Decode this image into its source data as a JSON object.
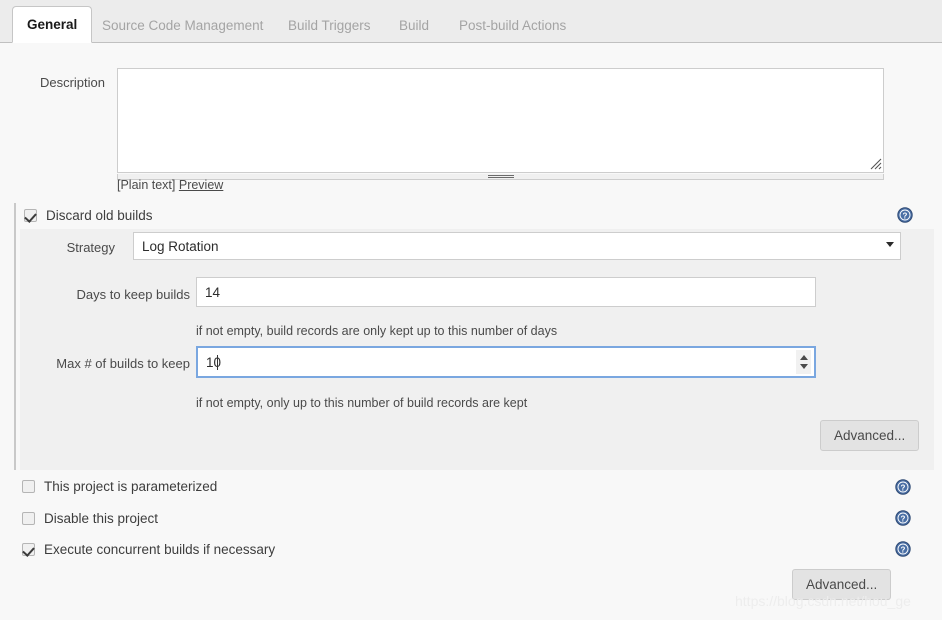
{
  "tabs": [
    {
      "label": "General",
      "active": true
    },
    {
      "label": "Source Code Management",
      "active": false
    },
    {
      "label": "Build Triggers",
      "active": false
    },
    {
      "label": "Build",
      "active": false
    },
    {
      "label": "Post-build Actions",
      "active": false
    }
  ],
  "description": {
    "label": "Description",
    "value": "",
    "placeholder": "",
    "markup_note": "[Plain text]",
    "preview_link": "Preview",
    "resize_handle_icon": "resize-grip-icon",
    "drag_bar_icon": "drag-grip-icon"
  },
  "discard_old_builds": {
    "label": "Discard old builds",
    "checked": true,
    "help_icon": "help-question-icon",
    "strategy": {
      "label": "Strategy",
      "value": "Log Rotation",
      "options": [
        "Log Rotation"
      ],
      "arrow_icon": "chevron-down-icon"
    },
    "days_to_keep": {
      "label": "Days to keep builds",
      "value": "14",
      "hint": "if not empty, build records are only kept up to this number of days"
    },
    "max_builds_to_keep": {
      "label": "Max # of builds to keep",
      "value": "10",
      "hint": "if not empty, only up to this number of build records are kept",
      "focused": true,
      "spinner_up_icon": "spinner-up-icon",
      "spinner_down_icon": "spinner-down-icon"
    },
    "advanced_button": "Advanced..."
  },
  "options": [
    {
      "label": "This project is parameterized",
      "checked": false,
      "help_icon": "help-question-icon"
    },
    {
      "label": "Disable this project",
      "checked": false,
      "help_icon": "help-question-icon"
    },
    {
      "label": "Execute concurrent builds if necessary",
      "checked": true,
      "help_icon": "help-question-icon"
    }
  ],
  "advanced_button": "Advanced...",
  "watermark": "https://blog.csdn.net/hou_ge",
  "colors": {
    "page_background": "#f8f8f8",
    "tabbar_background": "#ececec",
    "panel_background": "#f0f0f0",
    "focus_border": "#7aa7e0",
    "help_icon_blue": "#4a6fa5",
    "text": "#333333",
    "muted_text": "#a4a4a4"
  }
}
